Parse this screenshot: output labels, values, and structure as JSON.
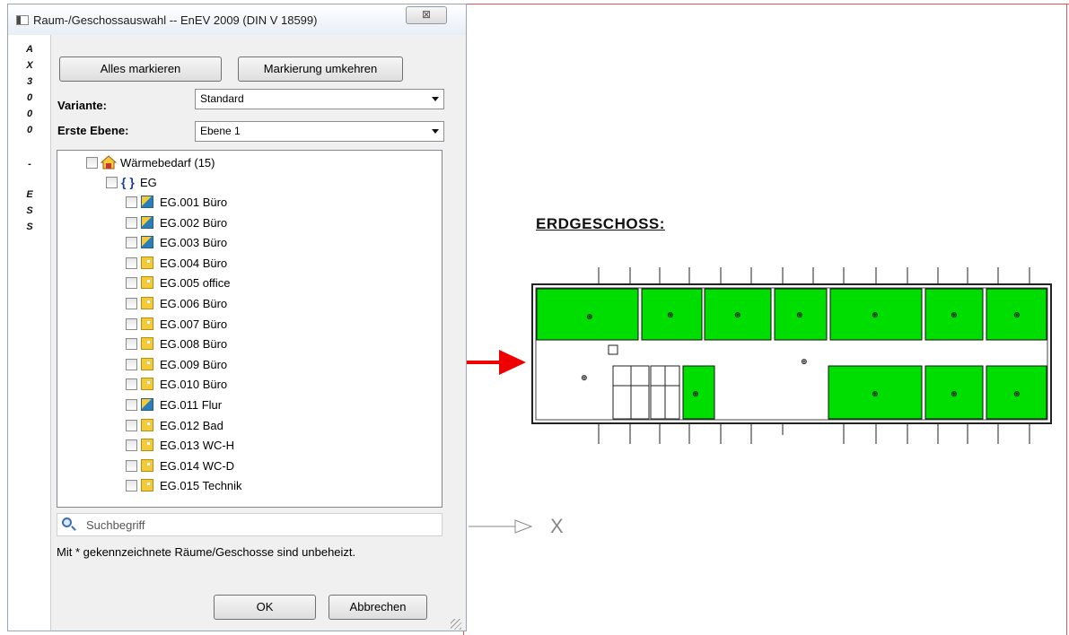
{
  "window": {
    "title": "Raum-/Geschossauswahl -- EnEV 2009 (DIN V 18599)",
    "close_label": "⊠",
    "side_letters": [
      "A",
      "X",
      "3",
      "0",
      "0",
      "0",
      "-",
      "E",
      "S",
      "S"
    ]
  },
  "toolbar": {
    "select_all_label": "Alles markieren",
    "invert_label": "Markierung umkehren"
  },
  "fields": {
    "variant_label": "Variante:",
    "variant_value": "Standard",
    "first_level_label": "Erste Ebene:",
    "first_level_value": "Ebene 1"
  },
  "tree": {
    "root_label": "Wärmebedarf (15)",
    "floor_label": "EG",
    "items": [
      {
        "label": "EG.001 Büro",
        "icon": "room-blue-icon"
      },
      {
        "label": "EG.002 Büro",
        "icon": "room-blue-icon"
      },
      {
        "label": "EG.003 Büro",
        "icon": "room-blue-icon"
      },
      {
        "label": "EG.004 Büro",
        "icon": "room-yellow-icon"
      },
      {
        "label": "EG.005 office",
        "icon": "room-yellow-icon"
      },
      {
        "label": "EG.006 Büro",
        "icon": "room-yellow-icon"
      },
      {
        "label": "EG.007 Büro",
        "icon": "room-yellow-icon"
      },
      {
        "label": "EG.008 Büro",
        "icon": "room-yellow-icon"
      },
      {
        "label": "EG.009 Büro",
        "icon": "room-yellow-icon"
      },
      {
        "label": "EG.010 Büro",
        "icon": "room-yellow-icon"
      },
      {
        "label": "EG.011 Flur",
        "icon": "room-blue-icon"
      },
      {
        "label": "EG.012 Bad",
        "icon": "room-yellow-icon"
      },
      {
        "label": "EG.013 WC-H",
        "icon": "room-yellow-icon"
      },
      {
        "label": "EG.014 WC-D",
        "icon": "room-yellow-icon"
      },
      {
        "label": "EG.015 Technik",
        "icon": "room-yellow-icon"
      }
    ]
  },
  "search": {
    "placeholder": "Suchbegriff"
  },
  "hint": "Mit * gekennzeichnete Räume/Geschosse sind unbeheizt.",
  "buttons": {
    "ok_label": "OK",
    "cancel_label": "Abbrechen"
  },
  "canvas": {
    "floor_title": "ERDGESCHOSS:",
    "axis_label": "X",
    "colors": {
      "room_fill": "#00dd00",
      "arrow": "#ee0000",
      "frame": "#e05555"
    }
  }
}
